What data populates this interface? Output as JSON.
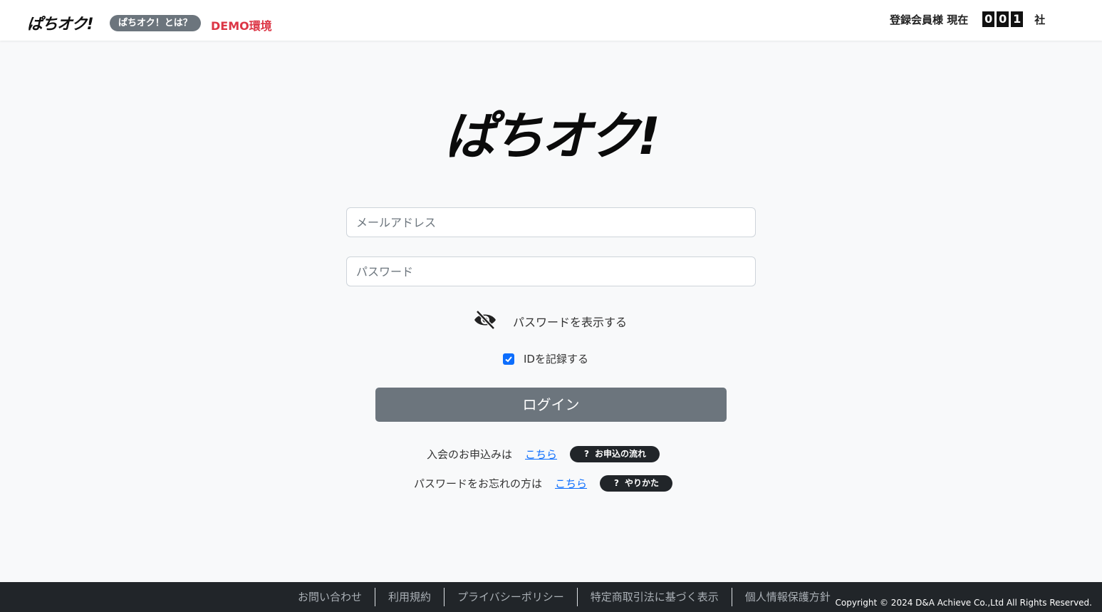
{
  "header": {
    "brand": "ぱちオク!",
    "about_label": "ぱちオク！とは？",
    "demo_label": "DEMO環境",
    "members_label": "登録会員様 現在",
    "members_digits": [
      "0",
      "0",
      "1"
    ],
    "members_unit": "社"
  },
  "main": {
    "logo_text": "ぱちオク!",
    "email_placeholder": "メールアドレス",
    "password_placeholder": "パスワード",
    "show_password_label": "パスワードを表示する",
    "remember_label": "IDを記録する",
    "remember_checked": true,
    "login_label": "ログイン",
    "signup": {
      "text": "入会のお申込みは",
      "link": "こちら",
      "help_label": "お申込の流れ"
    },
    "forgot": {
      "text": "パスワードをお忘れの方は",
      "link": "こちら",
      "help_label": "やりかた"
    }
  },
  "footer": {
    "links": [
      "お問い合わせ",
      "利用規約",
      "プライバシーポリシー",
      "特定商取引法に基づく表示",
      "個人情報保護方針"
    ],
    "copyright": "Copyright © 2024 D&A Achieve Co.,Ltd All Rights Reserved."
  },
  "colors": {
    "accent": "#0d6efd",
    "demo": "#dc3545",
    "button": "#6c757d",
    "footer_bg": "#212529"
  }
}
